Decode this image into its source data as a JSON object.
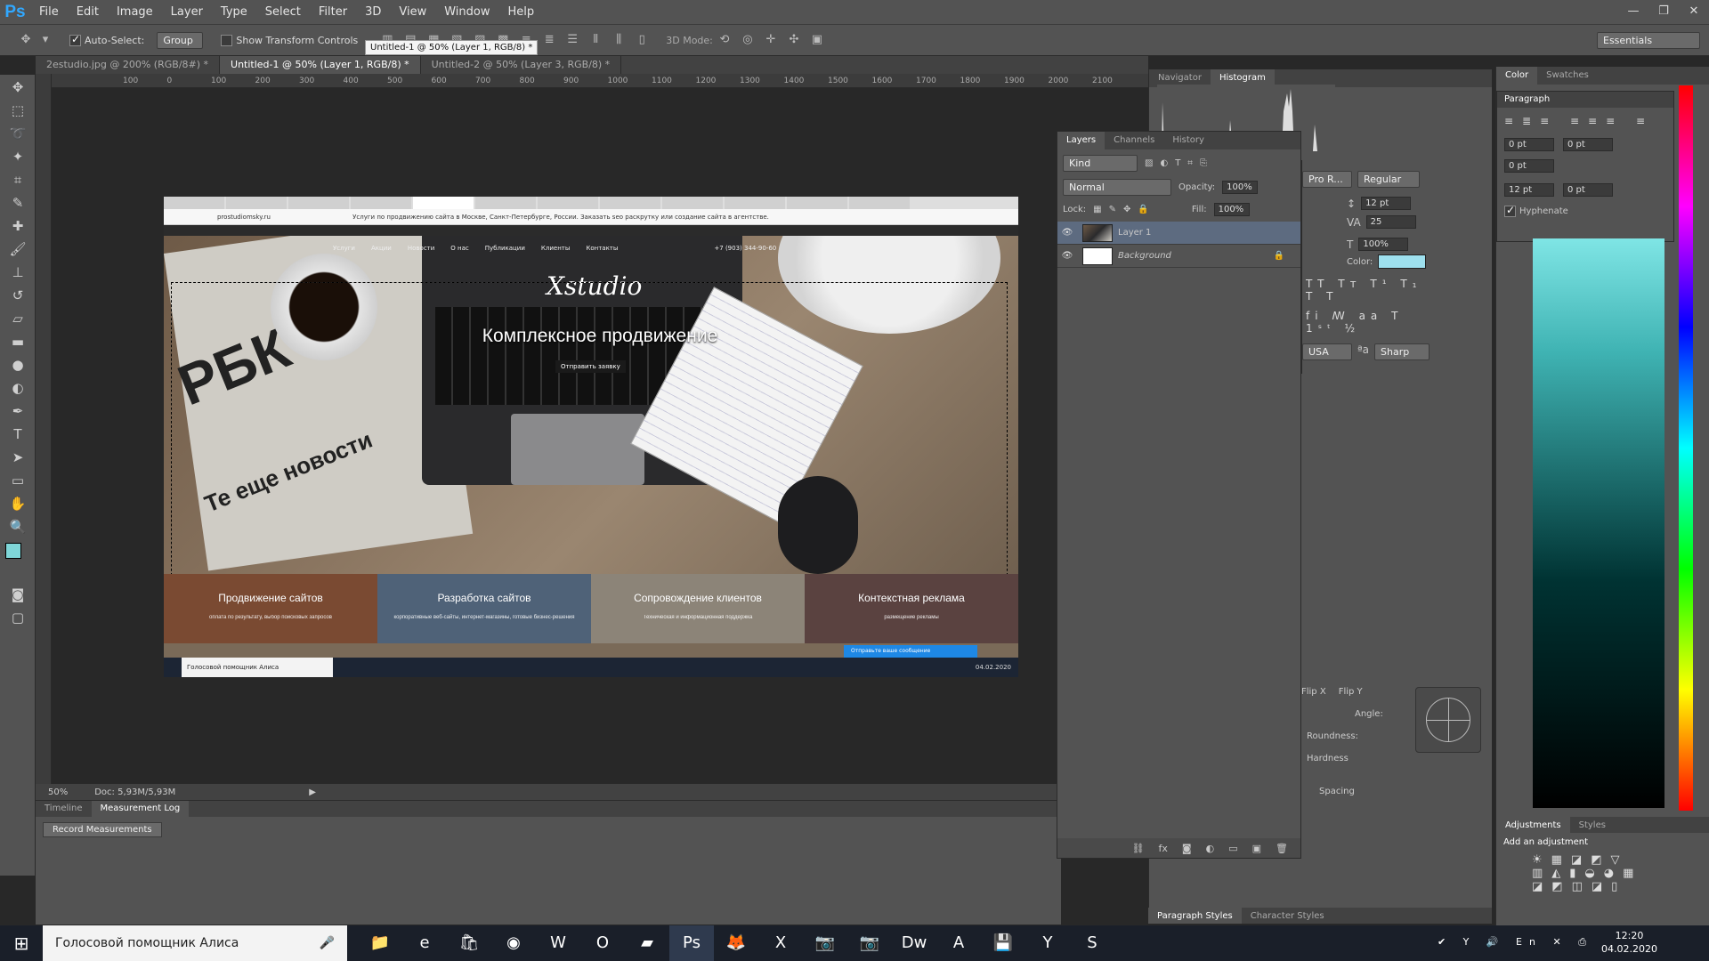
{
  "menu": {
    "logo": "Ps",
    "items": [
      "File",
      "Edit",
      "Image",
      "Layer",
      "Type",
      "Select",
      "Filter",
      "3D",
      "View",
      "Window",
      "Help"
    ]
  },
  "options": {
    "auto_select": "Auto-Select:",
    "group": "Group",
    "show_transform": "Show Transform Controls",
    "mode3d": "3D Mode:",
    "workspace": "Essentials"
  },
  "tooltip": "Untitled-1 @ 50% (Layer 1, RGB/8) *",
  "doc_tabs": [
    "2estudio.jpg @ 200% (RGB/8#) *",
    "Untitled-1 @ 50% (Layer 1, RGB/8) *",
    "Untitled-2 @ 50% (Layer 3, RGB/8) *"
  ],
  "ruler": [
    "100",
    "0",
    "100",
    "200",
    "300",
    "400",
    "500",
    "600",
    "700",
    "800",
    "900",
    "1000",
    "1100",
    "1200",
    "1300",
    "1400",
    "1500",
    "1600",
    "1700",
    "1800",
    "1900",
    "2000",
    "2100"
  ],
  "document": {
    "url": "prostudiomsky.ru",
    "url_title": "Услуги по продвижению сайта в Москве, Санкт-Петербурге, России. Заказать seo раскрутку или создание сайта в агентстве.",
    "nav": [
      "Услуги",
      "Акции",
      "Новости",
      "О нас",
      "Публикации",
      "Клиенты",
      "Контакты"
    ],
    "phone": "+7 (903) 344-90-60",
    "logo": "Xstudio",
    "hero_title": "Комплексное продвижение",
    "hero_btn": "Отправить заявку",
    "rbk": "РБК",
    "news": "Те еще новости",
    "tiles": [
      {
        "title": "Продвижение сайтов",
        "sub": "оплата по результату, выбор поисковых запросов"
      },
      {
        "title": "Разработка сайтов",
        "sub": "корпоративные веб-сайты, интернет-магазины, готовые бизнес-решения"
      },
      {
        "title": "Сопровождение клиентов",
        "sub": "Техническая и информационная поддержка"
      },
      {
        "title": "Контекстная реклама",
        "sub": "размещение рекламы"
      }
    ],
    "chat": "Отправьте ваше сообщение",
    "inner_search": "Голосовой помощник Алиса",
    "inner_date": "04.02.2020"
  },
  "status": {
    "zoom": "50%",
    "doc": "Doc: 5,93M/5,93M"
  },
  "bottom": {
    "tabs": [
      "Timeline",
      "Measurement Log"
    ],
    "record": "Record Measurements"
  },
  "layers": {
    "tabs": [
      "Layers",
      "Channels",
      "History"
    ],
    "kind": "Kind",
    "blend": "Normal",
    "opacity_label": "Opacity:",
    "opacity": "100%",
    "lock_label": "Lock:",
    "fill_label": "Fill:",
    "fill": "100%",
    "items": [
      {
        "name": "Layer 1"
      },
      {
        "name": "Background"
      }
    ]
  },
  "navigator": {
    "tabs": [
      "Navigator",
      "Histogram"
    ]
  },
  "character": {
    "font": "Pro R...",
    "style": "Regular",
    "size": "12 pt",
    "tracking": "25",
    "scale": "100%",
    "color_label": "Color:",
    "lang": "USA",
    "aa": "Sharp",
    "color": "#9ee0ee"
  },
  "brush": {
    "flip_x": "Flip X",
    "flip_y": "Flip Y",
    "angle": "Angle:",
    "roundness": "Roundness:",
    "hardness": "Hardness",
    "spacing": "Spacing"
  },
  "color_panel": {
    "tabs": [
      "Color",
      "Swatches"
    ]
  },
  "paragraph": {
    "title": "Paragraph",
    "indent": [
      "0 pt",
      "0 pt",
      "0 pt",
      "12 pt",
      "0 pt"
    ],
    "hyphenate": "Hyphenate"
  },
  "adjustments": {
    "tabs": [
      "Adjustments",
      "Styles"
    ],
    "add": "Add an adjustment"
  },
  "styles": {
    "tabs": [
      "Paragraph Styles",
      "Character Styles"
    ]
  },
  "taskbar": {
    "search": "Голосовой помощник Алиса",
    "time": "12:20",
    "date": "04.02.2020"
  }
}
